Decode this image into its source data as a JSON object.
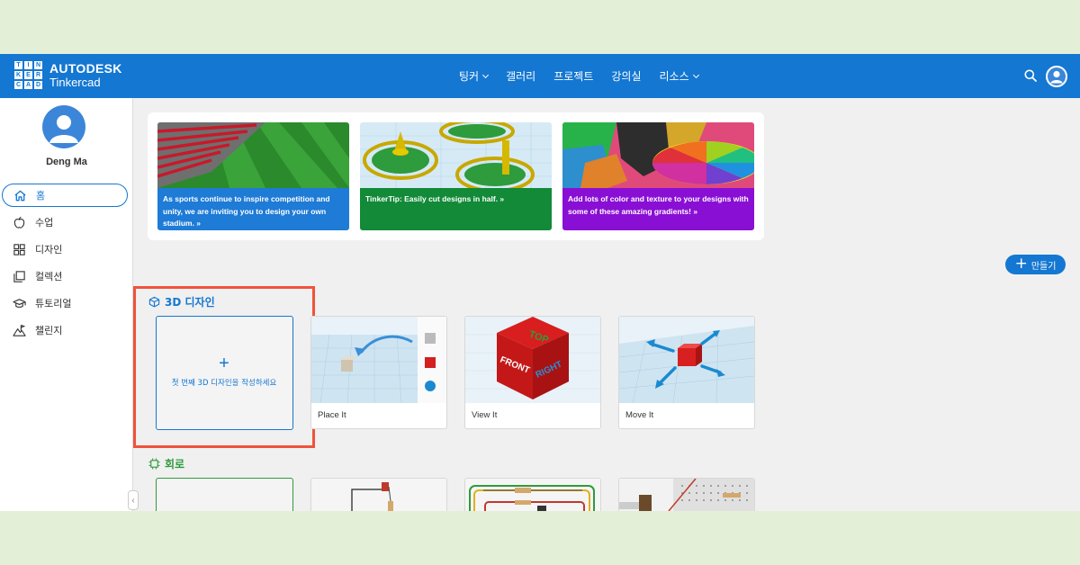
{
  "header": {
    "brand_line1": "AUTODESK",
    "brand_line2": "Tinkercad",
    "logo_letters": [
      "TIN",
      "KER",
      "CAD"
    ],
    "nav": [
      {
        "label": "팅커",
        "has_dropdown": true
      },
      {
        "label": "갤러리",
        "has_dropdown": false
      },
      {
        "label": "프로젝트",
        "has_dropdown": false
      },
      {
        "label": "강의실",
        "has_dropdown": false
      },
      {
        "label": "리소스",
        "has_dropdown": true
      }
    ],
    "icons": [
      "search-icon",
      "user-avatar-icon"
    ]
  },
  "sidebar": {
    "user_name": "Deng Ma",
    "items": [
      {
        "label": "홈",
        "icon": "home-icon",
        "active": true
      },
      {
        "label": "수업",
        "icon": "apple-icon",
        "active": false
      },
      {
        "label": "디자인",
        "icon": "grid-icon",
        "active": false
      },
      {
        "label": "컬렉션",
        "icon": "collection-icon",
        "active": false
      },
      {
        "label": "튜토리얼",
        "icon": "graduation-cap-icon",
        "active": false
      },
      {
        "label": "챌린지",
        "icon": "mountain-flag-icon",
        "active": false
      }
    ],
    "collapse_glyph": "‹"
  },
  "banner": {
    "promos": [
      {
        "text": "As sports continue to inspire competition and unity, we are inviting you to design your own stadium. »",
        "color": "#1e7bd6"
      },
      {
        "text": "TinkerTip: Easily cut designs in half. »",
        "color": "#128a38"
      },
      {
        "text": "Add lots of color and texture to your designs with some of these amazing gradients! »",
        "color": "#8a0fd4"
      }
    ]
  },
  "create_button": {
    "label": "만들기"
  },
  "sections": {
    "designs_3d": {
      "title": "3D 디자인",
      "first_card_text": "첫 번째 3D 디자인을 작성하세요",
      "cards": [
        {
          "label": "Place It"
        },
        {
          "label": "View It"
        },
        {
          "label": "Move It"
        }
      ],
      "cube_faces": {
        "top": "TOP",
        "front": "FRONT",
        "right": "RIGHT"
      }
    },
    "circuits": {
      "title": "회로"
    }
  },
  "colors": {
    "header_blue": "#1477d2",
    "highlight_red": "#f0533a",
    "circuit_green": "#2e9b3c",
    "page_bg": "#e3efd7"
  }
}
